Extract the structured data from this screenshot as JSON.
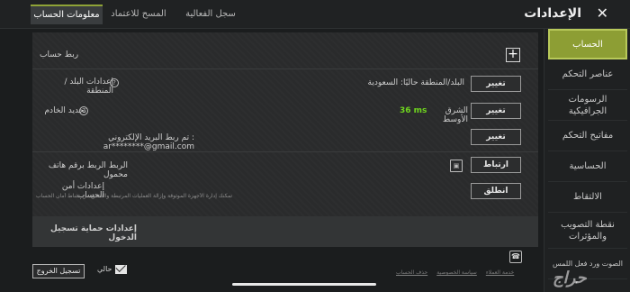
{
  "header": {
    "title": "الإعدادات",
    "close_icon": "close-icon",
    "tabs": [
      {
        "label": "سجل الفعالية"
      },
      {
        "label": "المسح للاعتماد"
      },
      {
        "label": "معلومات الحساب"
      }
    ]
  },
  "sidebar": {
    "items": [
      {
        "label": "الحساب"
      },
      {
        "label": "عناصر التحكم"
      },
      {
        "label": "الرسومات الجرافيكية"
      },
      {
        "label": "مفاتيح التحكم"
      },
      {
        "label": "الحساسية"
      },
      {
        "label": "الالتقاط"
      },
      {
        "label": "نقطة التصويب والمؤثرات"
      },
      {
        "label": "الصوت ورد فعل اللمس"
      }
    ]
  },
  "account": {
    "link_account_label": "ربط حساب",
    "region_label": "إعدادات البلد / المنطقة",
    "region_value": "البلد/المنطقة حاليًا: السعودية",
    "region_button": "تغيير",
    "server_label": "تحديد الخادم",
    "server_value": "الشرق الأوسط",
    "server_ping": "36 ms",
    "server_button": "تغيير",
    "email_linked": "تم ربط البريد الإلكتروني : ar********@gmail.com",
    "email_button": "تغيير",
    "phone_label": "الربط الربط برقم هاتف محمول",
    "phone_button": "ارتباط",
    "security_label": "إعدادات أمن الحساب",
    "security_note": "تمكنك إدارة الأجهزة الموثوقة وإزالة العمليات المرتبطة والتحقق من نشاط أمان الحساب",
    "security_button": "انطلق",
    "login_protection": "إعدادات حماية تسجيل الدخول"
  },
  "footer": {
    "logout": "تسجيل الخروج",
    "current": "حالي",
    "links": [
      "خدمة العملاء",
      "سياسة الخصوصية",
      "حذف الحساب"
    ],
    "support_icon": "headset-icon",
    "mail_icon": "mail-icon"
  },
  "watermark": "حراج",
  "colors": {
    "accent": "#8d9e34",
    "ping": "#6fd61e"
  }
}
